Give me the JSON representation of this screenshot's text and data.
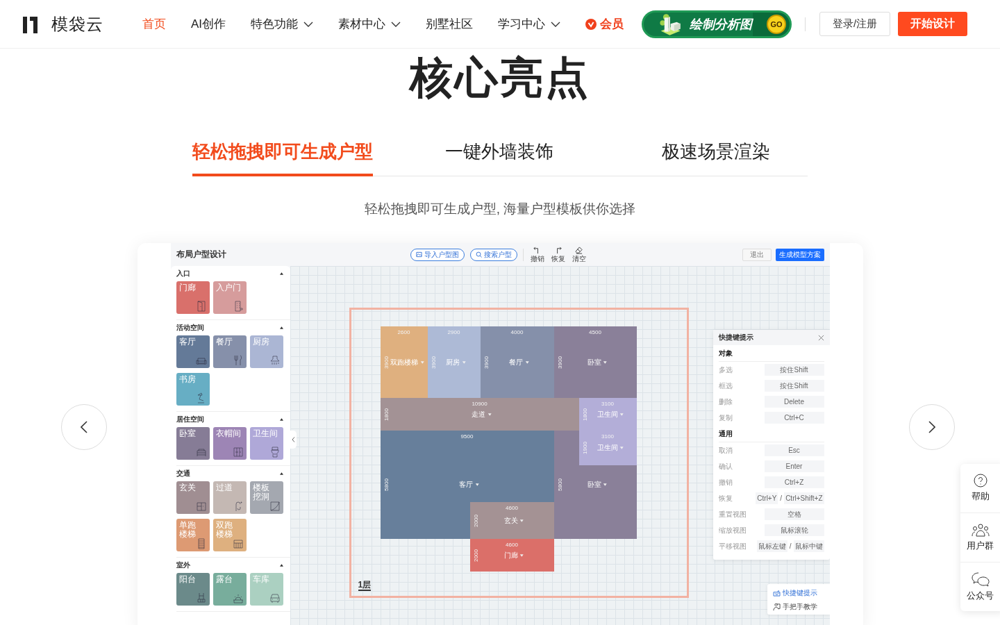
{
  "header": {
    "logo_text": "模袋云",
    "nav": [
      {
        "label": "首页",
        "selected": true,
        "dropdown": false,
        "kind": "plain"
      },
      {
        "label": "AI创作",
        "selected": false,
        "dropdown": false,
        "kind": "plain"
      },
      {
        "label": "特色功能",
        "selected": false,
        "dropdown": true,
        "kind": "plain"
      },
      {
        "label": "素材中心",
        "selected": false,
        "dropdown": true,
        "kind": "plain"
      },
      {
        "label": "别墅社区",
        "selected": false,
        "dropdown": false,
        "kind": "plain"
      },
      {
        "label": "学习中心",
        "selected": false,
        "dropdown": true,
        "kind": "plain"
      },
      {
        "label": "会员",
        "selected": false,
        "dropdown": false,
        "kind": "vip"
      }
    ],
    "promo": {
      "label": "绘制分析图",
      "go": "GO"
    },
    "login": "登录/注册",
    "start": "开始设计"
  },
  "hero": {
    "title": "核心亮点",
    "tabs": [
      {
        "label": "轻松拖拽即可生成户型",
        "selected": true
      },
      {
        "label": "一键外墙装饰",
        "selected": false
      },
      {
        "label": "极速场景渲染",
        "selected": false
      }
    ],
    "subtitle": "轻松拖拽即可生成户型, 海量户型模板供你选择"
  },
  "editor": {
    "title": "布局户型设计",
    "pills": [
      {
        "label": "导入户型图",
        "kind": "image"
      },
      {
        "label": "搜索户型",
        "kind": "search"
      }
    ],
    "tools": [
      {
        "label": "撤销",
        "kind": "undo"
      },
      {
        "label": "恢复",
        "kind": "redo"
      },
      {
        "label": "清空",
        "kind": "clear"
      }
    ],
    "exit": "退出",
    "generate": "生成模型方案",
    "palette": [
      {
        "name": "入口",
        "expanded": true,
        "tiles": [
          {
            "lines": [
              "门廊"
            ],
            "color": "#d9706b"
          },
          {
            "lines": [
              "入户门"
            ],
            "color": "#d69c9c"
          }
        ]
      },
      {
        "name": "活动空间",
        "expanded": true,
        "tiles": [
          {
            "lines": [
              "客厅"
            ],
            "color": "#647a98"
          },
          {
            "lines": [
              "餐厅"
            ],
            "color": "#8690aa"
          },
          {
            "lines": [
              "厨房"
            ],
            "color": "#abb6d4"
          },
          {
            "lines": [
              "书房"
            ],
            "color": "#67aec4"
          }
        ]
      },
      {
        "name": "居住空间",
        "expanded": true,
        "tiles": [
          {
            "lines": [
              "卧室"
            ],
            "color": "#867c96"
          },
          {
            "lines": [
              "衣帽间"
            ],
            "color": "#9d85b5"
          },
          {
            "lines": [
              "卫生间"
            ],
            "color": "#afa8d8"
          }
        ]
      },
      {
        "name": "交通",
        "expanded": true,
        "tiles": [
          {
            "lines": [
              "玄关"
            ],
            "color": "#a08e92"
          },
          {
            "lines": [
              "过道"
            ],
            "color": "#c4b8b3"
          },
          {
            "lines": [
              "楼板",
              "挖洞"
            ],
            "color": "#a4a8b0"
          },
          {
            "lines": [
              "单跑",
              "楼梯"
            ],
            "color": "#dd9a73"
          },
          {
            "lines": [
              "双跑",
              "楼梯"
            ],
            "color": "#deb07f"
          }
        ]
      },
      {
        "name": "室外",
        "expanded": true,
        "tiles": [
          {
            "lines": [
              "阳台"
            ],
            "color": "#6b8a8a"
          },
          {
            "lines": [
              "露台"
            ],
            "color": "#78ad9c"
          },
          {
            "lines": [
              "车库"
            ],
            "color": "#abd0c1"
          }
        ]
      }
    ],
    "plan": {
      "floor": "1层",
      "rooms": [
        {
          "name": "双跑楼梯",
          "width_label": "2600",
          "height_label": "3900",
          "color": "#dfb07f"
        },
        {
          "name": "厨房",
          "width_label": "2900",
          "height_label": "3900",
          "color": "#adbad6"
        },
        {
          "name": "餐厅",
          "width_label": "4000",
          "height_label": "3900",
          "color": "#8590aa"
        },
        {
          "name": "卧室",
          "width_label": "4500",
          "height_label": "3900",
          "color": "#8a8099"
        },
        {
          "name": "走道",
          "width_label": "10900",
          "height_label": "1800",
          "color": "#a39295"
        },
        {
          "name": "卧室",
          "height_label": "5800",
          "color": "#8a8099"
        },
        {
          "name": "客厅",
          "width_label": "9500",
          "height_label": "5800",
          "color": "#677f9b"
        },
        {
          "name": "卫生间",
          "width_label": "3100",
          "height_label": "1800",
          "color": "#b3aed8"
        },
        {
          "name": "卫生间",
          "width_label": "3100",
          "height_label": "1900",
          "color": "#b3aed8"
        },
        {
          "name": "玄关",
          "width_label": "4600",
          "height_label": "2000",
          "color": "#a49294"
        },
        {
          "name": "门廊",
          "width_label": "4600",
          "height_label": "2000",
          "color": "#db6f69"
        }
      ]
    },
    "shortcuts": {
      "title": "快捷键提示",
      "sections": [
        {
          "name": "对象",
          "rows": [
            {
              "action": "多选",
              "keys": [
                "按住Shift"
              ]
            },
            {
              "action": "框选",
              "keys": [
                "按住Shift"
              ]
            },
            {
              "action": "删除",
              "keys": [
                "Delete"
              ]
            },
            {
              "action": "复制",
              "keys": [
                "Ctrl+C"
              ]
            }
          ]
        },
        {
          "name": "通用",
          "rows": [
            {
              "action": "取消",
              "keys": [
                "Esc"
              ]
            },
            {
              "action": "确认",
              "keys": [
                "Enter"
              ]
            },
            {
              "action": "撤销",
              "keys": [
                "Ctrl+Z"
              ]
            },
            {
              "action": "恢复",
              "keys": [
                "Ctrl+Y",
                "Ctrl+Shift+Z"
              ],
              "separator": "/"
            },
            {
              "action": "重置视图",
              "keys": [
                "空格"
              ]
            },
            {
              "action": "缩放视图",
              "keys": [
                "鼠标滚轮"
              ]
            },
            {
              "action": "平移视图",
              "keys": [
                "鼠标左键",
                "鼠标中键"
              ],
              "separator": "/"
            }
          ]
        }
      ]
    },
    "help_links": [
      {
        "label": "快捷键提示",
        "kind": "keyboard"
      },
      {
        "label": "手把手教学",
        "kind": "tutor"
      }
    ]
  },
  "side_bar": [
    {
      "label": "帮助",
      "kind": "help"
    },
    {
      "label": "用户群",
      "kind": "users"
    },
    {
      "label": "公众号",
      "kind": "wechat"
    }
  ]
}
